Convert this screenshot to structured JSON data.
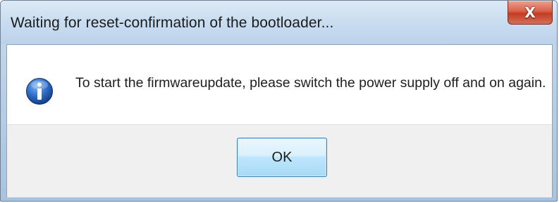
{
  "window": {
    "title": "Waiting for reset-confirmation of the bootloader...",
    "close_glyph": "X"
  },
  "dialog": {
    "icon": "information-icon",
    "message": "To start the firmwareupdate, please switch the power supply off and on again.",
    "ok_label": "OK"
  },
  "colors": {
    "titlebar": "#c9dcef",
    "close_button": "#c43c22",
    "ok_button_border": "#3c7fb1",
    "info_icon": "#1f5fb5"
  }
}
